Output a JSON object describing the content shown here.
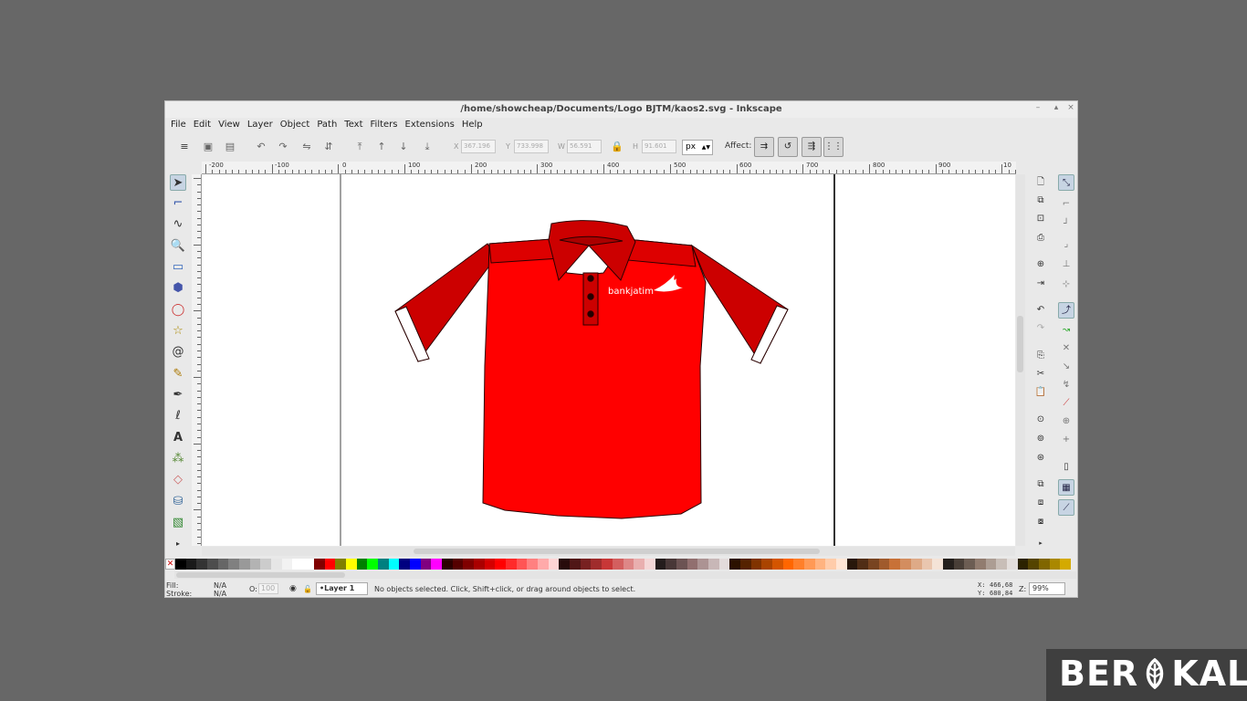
{
  "window": {
    "title": "/home/showcheap/Documents/Logo BJTM/kaos2.svg - Inkscape",
    "controls": [
      "–",
      "▴",
      "×"
    ]
  },
  "menu": [
    "File",
    "Edit",
    "View",
    "Layer",
    "Object",
    "Path",
    "Text",
    "Filters",
    "Extensions",
    "Help"
  ],
  "toolbar": {
    "x_value": "367.196",
    "y_value": "733.998",
    "w_value": "56.591",
    "h_value": "91.601",
    "x_label": "X",
    "y_label": "Y",
    "w_label": "W",
    "h_label": "H",
    "unit": "px",
    "affect_label": "Affect:"
  },
  "ruler": {
    "labels": [
      "-200",
      "-100",
      "0",
      "100",
      "200",
      "300",
      "400",
      "500",
      "600",
      "700",
      "800",
      "900",
      "10"
    ]
  },
  "canvas": {
    "logo_text": "bankjatim"
  },
  "colors": {
    "shirt_body": "#ff0000",
    "shirt_dark": "#cc0000",
    "shirt_outline": "#2a0000",
    "window_bg": "#676767"
  },
  "tools": [
    "selector-icon",
    "node-editor-icon",
    "tweak-icon",
    "zoom-icon",
    "rectangle-icon",
    "3d-box-icon",
    "ellipse-icon",
    "star-icon",
    "spiral-icon",
    "pencil-icon",
    "pen-icon",
    "calligraphy-icon",
    "text-icon",
    "spray-icon",
    "eraser-icon",
    "paint-bucket-icon",
    "gradient-icon"
  ],
  "status": {
    "fill_label": "Fill:",
    "fill_value": "N/A",
    "stroke_label": "Stroke:",
    "stroke_value": "N/A",
    "opacity_label": "O:",
    "opacity_value": "100",
    "layer": "•Layer 1",
    "message": "No objects selected. Click, Shift+click, or drag around objects to select.",
    "x_label": "X:",
    "x_coord": "466,68",
    "y_label": "Y:",
    "y_coord": "680,84",
    "zoom_label": "Z:",
    "zoom_value": "99%"
  },
  "watermark": {
    "text": "BERKAL"
  }
}
